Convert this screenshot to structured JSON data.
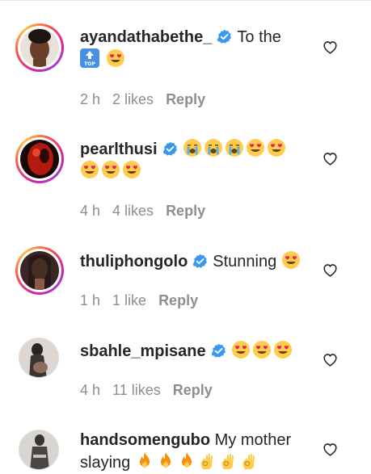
{
  "comments": [
    {
      "username": "ayandathabethe_",
      "text": "To the",
      "line2_icon": "top-arrow-icon",
      "line2_emojis": [
        "heart-eyes"
      ],
      "time": "2 h",
      "likes": "2 likes",
      "reply": "Reply",
      "avatar_colors": [
        "#e7b792",
        "#3a2a22"
      ]
    },
    {
      "username": "pearlthusi",
      "text": "",
      "line1_emojis": [
        "crying",
        "crying",
        "crying",
        "heart-eyes",
        "heart-eyes"
      ],
      "line2_emojis": [
        "heart-eyes",
        "heart-eyes",
        "heart-eyes"
      ],
      "time": "4 h",
      "likes": "4 likes",
      "reply": "Reply",
      "avatar_colors": [
        "#b21f12",
        "#1a0b08"
      ]
    },
    {
      "username": "thuliphongolo",
      "text": "Stunning",
      "line1_emojis": [
        "heart-eyes"
      ],
      "time": "1 h",
      "likes": "1 like",
      "reply": "Reply",
      "avatar_colors": [
        "#6b3d37",
        "#221816"
      ]
    },
    {
      "username": "sbahle_mpisane",
      "text": "",
      "line1_emojis": [
        "heart-eyes",
        "heart-eyes",
        "heart-eyes"
      ],
      "time": "4 h",
      "likes": "11 likes",
      "reply": "Reply",
      "avatar_colors": [
        "#d9d4d0",
        "#3b3431"
      ]
    },
    {
      "username": "handsomengubo",
      "text": "My mother",
      "line2_text": "slaying",
      "line2_emojis": [
        "fire",
        "fire",
        "fire",
        "ok-hand",
        "ok-hand",
        "ok-hand"
      ],
      "avatar_colors": [
        "#cfcac5",
        "#3f3a35"
      ]
    }
  ],
  "colors": {
    "verified": "#3897f0",
    "meta": "#8e8e8e",
    "text": "#262626"
  }
}
